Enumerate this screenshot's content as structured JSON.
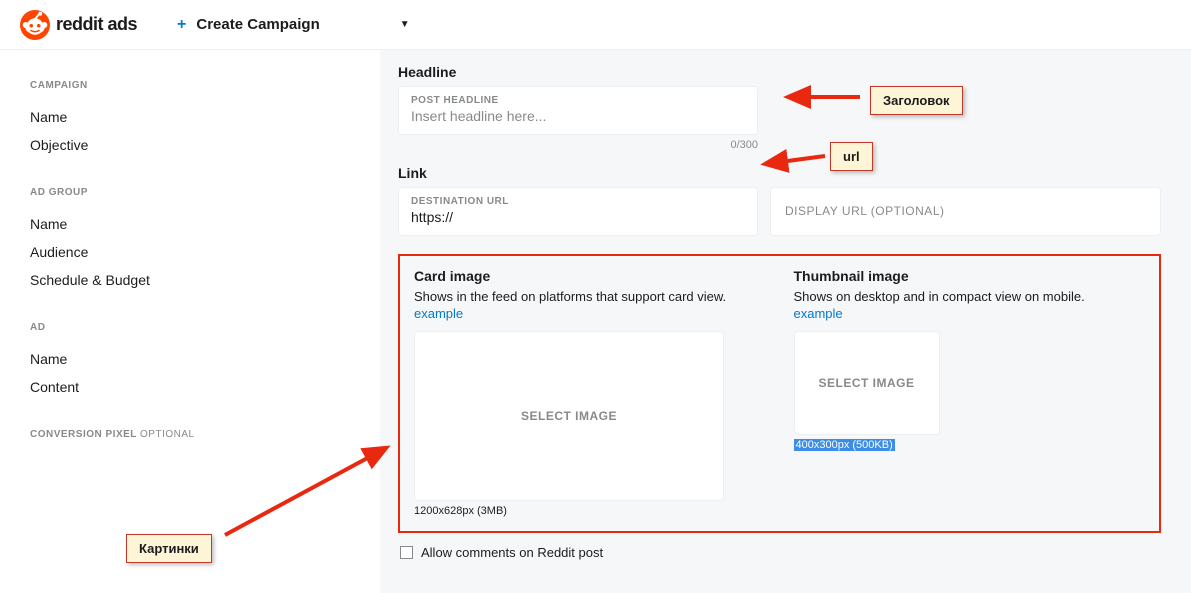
{
  "header": {
    "brand_text": "reddit ads",
    "create_label": "Create Campaign"
  },
  "sidebar": {
    "sections": [
      {
        "heading": "CAMPAIGN",
        "items": [
          "Name",
          "Objective"
        ]
      },
      {
        "heading": "AD GROUP",
        "items": [
          "Name",
          "Audience",
          "Schedule & Budget"
        ]
      },
      {
        "heading": "AD",
        "items": [
          "Name",
          "Content"
        ]
      },
      {
        "heading": "CONVERSION PIXEL",
        "suffix": "OPTIONAL",
        "items": []
      }
    ]
  },
  "form": {
    "headline_label": "Headline",
    "headline_mini": "POST HEADLINE",
    "headline_placeholder": "Insert headline here...",
    "headline_counter": "0/300",
    "link_label": "Link",
    "dest_mini": "DESTINATION URL",
    "dest_value": "https://",
    "display_placeholder": "DISPLAY URL (OPTIONAL)",
    "card": {
      "heading": "Card image",
      "desc": "Shows in the feed on platforms that support card view.",
      "example": "example",
      "select": "SELECT IMAGE",
      "size": "1200x628px (3MB)"
    },
    "thumb": {
      "heading": "Thumbnail image",
      "desc": "Shows on desktop and in compact view on mobile.",
      "example": "example",
      "select": "SELECT IMAGE",
      "size": "400x300px (500KB)"
    },
    "allow_comments": "Allow comments on Reddit post"
  },
  "annotations": {
    "title": "Заголовок",
    "url": "url",
    "images": "Картинки"
  }
}
